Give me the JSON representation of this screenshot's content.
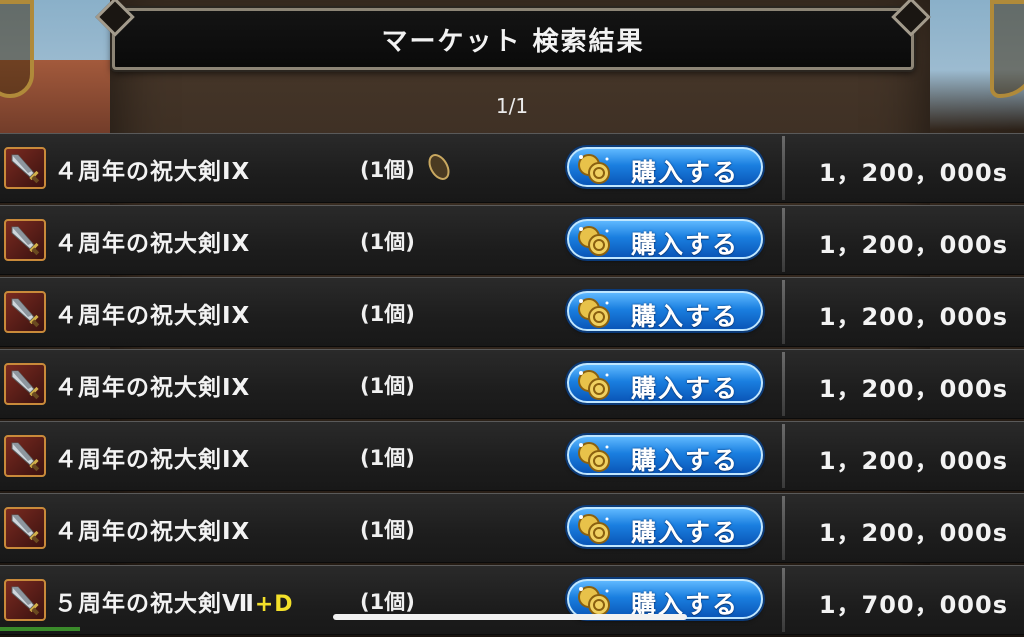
{
  "header": {
    "title": "マーケット 検索結果",
    "page_indicator": "1/1"
  },
  "buy_label": "購入する",
  "icons": {
    "item": "sword-icon",
    "lock": "seal-lock-icon",
    "currency": "coin-icon"
  },
  "colors": {
    "button_blue": "#1a7fe0",
    "suffix_yellow": "#f3e02a",
    "item_frame": "#c98a3a"
  },
  "listings": [
    {
      "name": "４周年の祝大剣IX",
      "suffix": "",
      "quantity": "(1個)",
      "locked": true,
      "price": "1，200，000s"
    },
    {
      "name": "４周年の祝大剣IX",
      "suffix": "",
      "quantity": "(1個)",
      "locked": false,
      "price": "1，200，000s"
    },
    {
      "name": "４周年の祝大剣IX",
      "suffix": "",
      "quantity": "(1個)",
      "locked": false,
      "price": "1，200，000s"
    },
    {
      "name": "４周年の祝大剣IX",
      "suffix": "",
      "quantity": "(1個)",
      "locked": false,
      "price": "1，200，000s"
    },
    {
      "name": "４周年の祝大剣IX",
      "suffix": "",
      "quantity": "(1個)",
      "locked": false,
      "price": "1，200，000s"
    },
    {
      "name": "４周年の祝大剣IX",
      "suffix": "",
      "quantity": "(1個)",
      "locked": false,
      "price": "1，200，000s"
    },
    {
      "name": "５周年の祝大剣Ⅶ",
      "suffix": "+D",
      "quantity": "(1個)",
      "locked": false,
      "price": "1，700，000s"
    }
  ]
}
